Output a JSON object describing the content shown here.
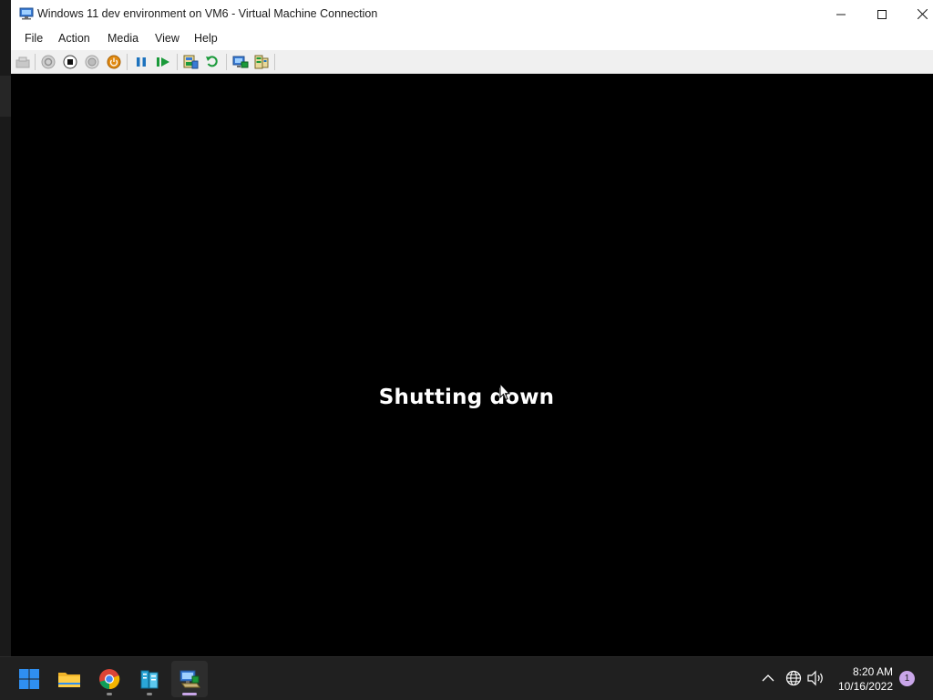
{
  "window": {
    "title": "Windows 11 dev environment on VM6 - Virtual Machine Connection",
    "controls": [
      "minimize",
      "maximize",
      "close"
    ]
  },
  "menu": {
    "items": [
      "File",
      "Action",
      "Media",
      "View",
      "Help"
    ]
  },
  "toolbar": {
    "buttons": [
      {
        "name": "ctrl-alt-del-icon",
        "enabled": false
      },
      {
        "name": "start-icon",
        "enabled": false
      },
      {
        "name": "turn-off-icon",
        "enabled": true
      },
      {
        "name": "shut-down-icon",
        "enabled": false
      },
      {
        "name": "save-icon",
        "enabled": true
      },
      {
        "name": "pause-icon",
        "enabled": true
      },
      {
        "name": "resume-icon",
        "enabled": true
      },
      {
        "name": "checkpoint-icon",
        "enabled": true
      },
      {
        "name": "revert-icon",
        "enabled": true
      },
      {
        "name": "enhanced-session-icon",
        "enabled": true
      },
      {
        "name": "share-icon",
        "enabled": true
      }
    ]
  },
  "screen": {
    "status_text": "Shutting down"
  },
  "taskbar": {
    "apps": [
      "start-icon",
      "file-explorer-icon",
      "chrome-icon",
      "server-manager-icon",
      "hyper-v-connection-icon"
    ],
    "time": "8:20 AM",
    "date": "10/16/2022",
    "notification_count": "1"
  },
  "colors": {
    "accent": "#c9a6e9",
    "toolbar_green": "#1a9a3a",
    "toolbar_blue": "#1e73be",
    "toolbar_orange": "#e08a12"
  }
}
